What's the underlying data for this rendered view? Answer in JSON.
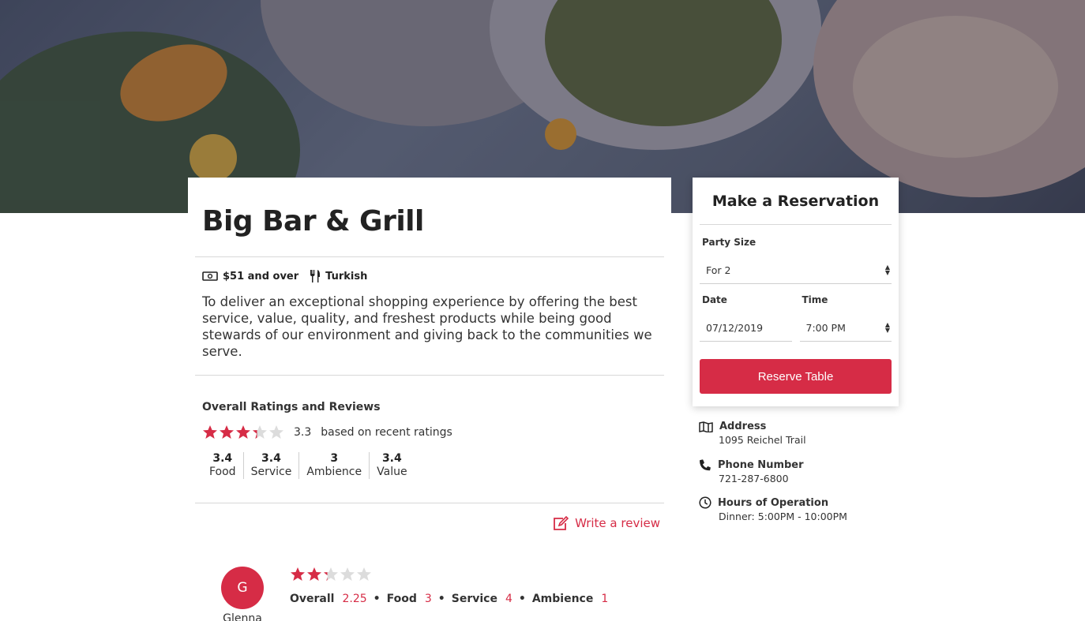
{
  "restaurant": {
    "name": "Big Bar & Grill",
    "price": "$51 and over",
    "cuisine": "Turkish",
    "description": "To deliver an exceptional shopping experience by offering the best service, value, quality, and freshest products while being good stewards of our environment and giving back to the communities we serve."
  },
  "ratings": {
    "heading": "Overall Ratings and Reviews",
    "stars_value": 3.3,
    "score": "3.3",
    "score_text": "based on recent ratings",
    "subs": [
      {
        "value": "3.4",
        "label": "Food"
      },
      {
        "value": "3.4",
        "label": "Service"
      },
      {
        "value": "3",
        "label": "Ambience"
      },
      {
        "value": "3.4",
        "label": "Value"
      }
    ],
    "write_review": "Write a review"
  },
  "review": {
    "avatar_letter": "G",
    "reviewer": "Glenna",
    "stars_value": 2.25,
    "overall_label": "Overall",
    "overall": "2.25",
    "food_label": "Food",
    "food": "3",
    "service_label": "Service",
    "service": "4",
    "ambience_label": "Ambience",
    "ambience": "1",
    "separator": "•"
  },
  "reservation": {
    "title": "Make a Reservation",
    "party_label": "Party Size",
    "party_value": "For 2",
    "date_label": "Date",
    "date_value": "07/12/2019",
    "time_label": "Time",
    "time_value": "7:00 PM",
    "button": "Reserve Table"
  },
  "info": {
    "address_label": "Address",
    "address": "1095 Reichel Trail",
    "phone_label": "Phone Number",
    "phone": "721-287-6800",
    "hours_label": "Hours of Operation",
    "hours": "Dinner: 5:00PM - 10:00PM"
  },
  "colors": {
    "accent": "#d62c46",
    "star_empty": "#dcdcdc"
  }
}
